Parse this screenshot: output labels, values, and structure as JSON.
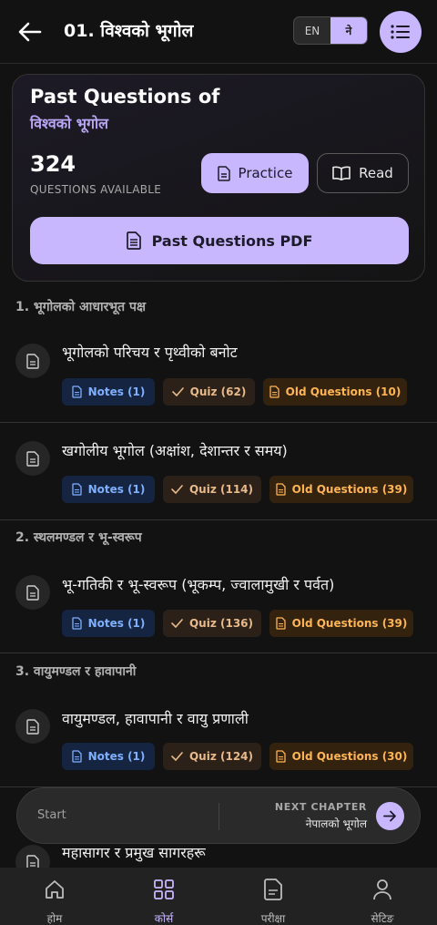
{
  "header": {
    "title": "01. विश्वको भूगोल",
    "lang_en": "EN",
    "lang_ne": "ने"
  },
  "summary": {
    "title": "Past Questions of",
    "subject": "विश्वको भूगोल",
    "count": "324",
    "count_label": "QUESTIONS AVAILABLE",
    "practice_label": "Practice",
    "read_label": "Read",
    "pdf_label": "Past Questions PDF"
  },
  "sections": [
    {
      "title": "1. भूगोलको आधारभूत पक्ष",
      "topics": [
        {
          "title": "भूगोलको परिचय र पृथ्वीको बनोट",
          "notes": "Notes (1)",
          "quiz": "Quiz (62)",
          "old": "Old Questions (10)"
        },
        {
          "title": "खगोलीय भूगोल (अक्षांश, देशान्तर र समय)",
          "notes": "Notes (1)",
          "quiz": "Quiz (114)",
          "old": "Old Questions (39)"
        }
      ]
    },
    {
      "title": "2. स्थलमण्डल र भू-स्वरूप",
      "topics": [
        {
          "title": "भू-गतिकी र भू-स्वरूप (भूकम्प, ज्वालामुखी र पर्वत)",
          "notes": "Notes (1)",
          "quiz": "Quiz (136)",
          "old": "Old Questions (39)"
        }
      ]
    },
    {
      "title": "3. वायुमण्डल र हावापानी",
      "topics": [
        {
          "title": "वायुमण्डल, हावापानी र वायु प्रणाली",
          "notes": "Notes (1)",
          "quiz": "Quiz (124)",
          "old": "Old Questions (30)"
        }
      ]
    },
    {
      "title": "",
      "topics": [
        {
          "title": "महासागर र प्रमुख सागरहरू"
        }
      ]
    }
  ],
  "next_chapter": {
    "start_label": "Start",
    "label": "NEXT CHAPTER",
    "name": "नेपालको भूगोल"
  },
  "bottom_nav": {
    "items": [
      {
        "label": "होम",
        "icon": "home-icon"
      },
      {
        "label": "कोर्स",
        "icon": "grid-icon"
      },
      {
        "label": "परीक्षा",
        "icon": "document-icon"
      },
      {
        "label": "सेटिङ",
        "icon": "user-icon"
      }
    ],
    "active_index": 1
  },
  "colors": {
    "accent": "#c8b6ff",
    "background": "#121212",
    "notes_chip": "#152440",
    "quiz_chip": "#2c2118",
    "old_chip": "#33230e"
  }
}
